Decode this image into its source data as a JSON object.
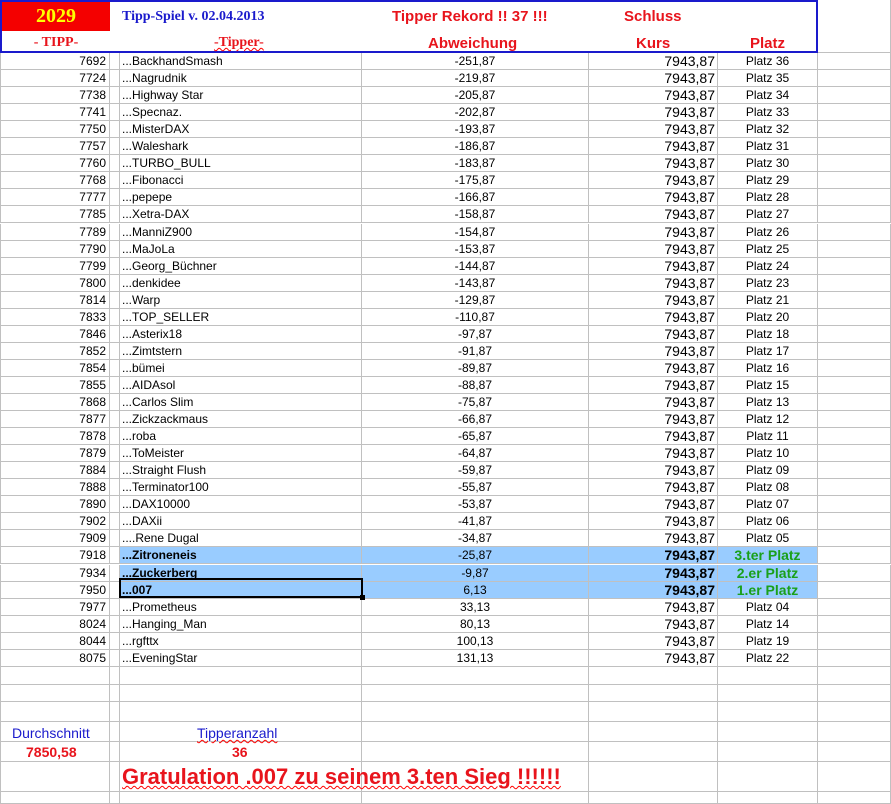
{
  "header": {
    "year": "2029",
    "title": "Tipp-Spiel v. 02.04.2013",
    "rekord": "Tipper Rekord !!  37  !!!",
    "schluss": "Schluss",
    "col_tipp": "- TIPP-",
    "col_tipper": "-Tipper-",
    "col_abweichung": "Abweichung",
    "col_kurs": "Kurs",
    "col_platz": "Platz"
  },
  "rows": [
    [
      "7692",
      "...BackhandSmash",
      "-251,87",
      "7943,87",
      "Platz 36"
    ],
    [
      "7724",
      "...Nagrudnik",
      "-219,87",
      "7943,87",
      "Platz 35"
    ],
    [
      "7738",
      "...Highway Star",
      "-205,87",
      "7943,87",
      "Platz 34"
    ],
    [
      "7741",
      "...Specnaz.",
      "-202,87",
      "7943,87",
      "Platz 33"
    ],
    [
      "7750",
      "...MisterDAX",
      "-193,87",
      "7943,87",
      "Platz 32"
    ],
    [
      "7757",
      "...Waleshark",
      "-186,87",
      "7943,87",
      "Platz 31"
    ],
    [
      "7760",
      "...TURBO_BULL",
      "-183,87",
      "7943,87",
      "Platz 30"
    ],
    [
      "7768",
      "...Fibonacci",
      "-175,87",
      "7943,87",
      "Platz 29"
    ],
    [
      "7777",
      "...pepepe",
      "-166,87",
      "7943,87",
      "Platz 28"
    ],
    [
      "7785",
      "...Xetra-DAX",
      "-158,87",
      "7943,87",
      "Platz 27"
    ],
    [
      "7789",
      "...ManniZ900",
      "-154,87",
      "7943,87",
      "Platz 26"
    ],
    [
      "7790",
      "...MaJoLa",
      "-153,87",
      "7943,87",
      "Platz 25"
    ],
    [
      "7799",
      "...Georg_Büchner",
      "-144,87",
      "7943,87",
      "Platz 24"
    ],
    [
      "7800",
      "...denkidee",
      "-143,87",
      "7943,87",
      "Platz 23"
    ],
    [
      "7814",
      "...Warp",
      "-129,87",
      "7943,87",
      "Platz 21"
    ],
    [
      "7833",
      "...TOP_SELLER",
      "-110,87",
      "7943,87",
      "Platz 20"
    ],
    [
      "7846",
      "...Asterix18",
      "-97,87",
      "7943,87",
      "Platz 18"
    ],
    [
      "7852",
      "...Zimtstern",
      "-91,87",
      "7943,87",
      "Platz 17"
    ],
    [
      "7854",
      "...bümei",
      "-89,87",
      "7943,87",
      "Platz 16"
    ],
    [
      "7855",
      "...AIDAsol",
      "-88,87",
      "7943,87",
      "Platz 15"
    ],
    [
      "7868",
      "...Carlos Slim",
      "-75,87",
      "7943,87",
      "Platz 13"
    ],
    [
      "7877",
      "...Zickzackmaus",
      "-66,87",
      "7943,87",
      "Platz 12"
    ],
    [
      "7878",
      "...roba",
      "-65,87",
      "7943,87",
      "Platz 11"
    ],
    [
      "7879",
      "...ToMeister",
      "-64,87",
      "7943,87",
      "Platz 10"
    ],
    [
      "7884",
      "...Straight Flush",
      "-59,87",
      "7943,87",
      "Platz 09"
    ],
    [
      "7888",
      "...Terminator100",
      "-55,87",
      "7943,87",
      "Platz 08"
    ],
    [
      "7890",
      "...DAX10000",
      "-53,87",
      "7943,87",
      "Platz 07"
    ],
    [
      "7902",
      "...DAXii",
      "-41,87",
      "7943,87",
      "Platz 06"
    ],
    [
      "7909",
      "....Rene Dugal",
      "-34,87",
      "7943,87",
      "Platz 05"
    ],
    [
      "7918",
      "...Zitroneneis",
      "-25,87",
      "7943,87",
      "3.ter Platz"
    ],
    [
      "7934",
      "...Zuckerberg",
      "-9,87",
      "7943,87",
      "2.er Platz"
    ],
    [
      "7950",
      "...007",
      "6,13",
      "7943,87",
      "1.er Platz"
    ],
    [
      "7977",
      "...Prometheus",
      "33,13",
      "7943,87",
      "Platz 04"
    ],
    [
      "8024",
      "...Hanging_Man",
      "80,13",
      "7943,87",
      "Platz 14"
    ],
    [
      "8044",
      "...rgfttx",
      "100,13",
      "7943,87",
      "Platz 19"
    ],
    [
      "8075",
      "...EveningStar",
      "131,13",
      "7943,87",
      "Platz 22"
    ]
  ],
  "highlight_rows": [
    29,
    30,
    31
  ],
  "footer": {
    "durchschnitt_label": "Durchschnitt",
    "durchschnitt_value": "7850,58",
    "tipperanzahl_label": "Tipperanzahl",
    "tipperanzahl_value": "36",
    "gratulation": "Gratulation .007 zu seinem 3.ten Sieg !!!!!!"
  }
}
